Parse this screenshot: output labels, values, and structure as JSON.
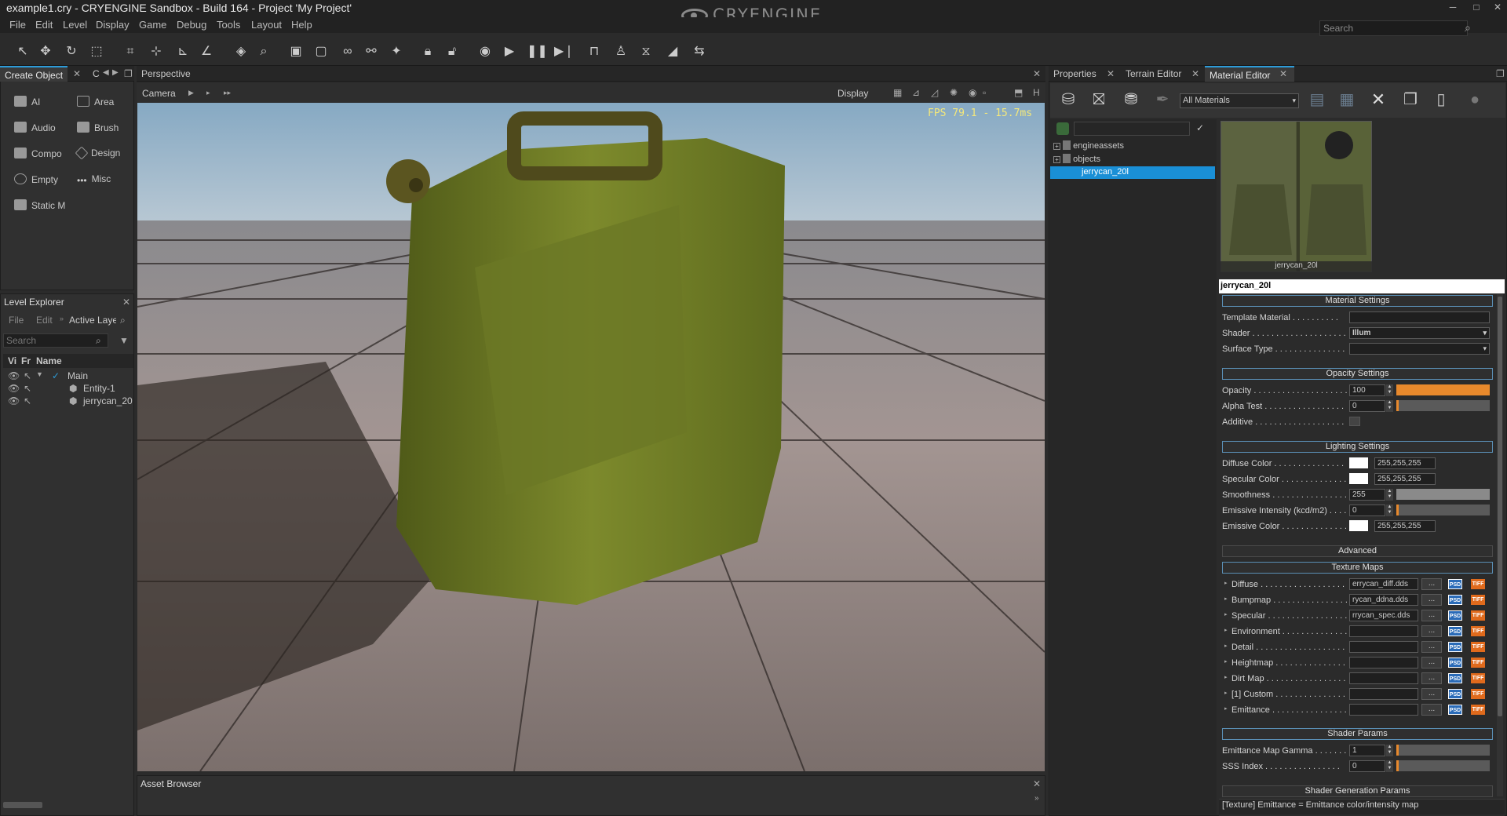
{
  "window": {
    "title": "example1.cry - CRYENGINE Sandbox - Build 164 - Project 'My Project'",
    "logo": "CRYENGINE",
    "controls": [
      "─",
      "□",
      "✕"
    ]
  },
  "menu": [
    "File",
    "Edit",
    "Level",
    "Display",
    "Game",
    "Debug",
    "Tools",
    "Layout",
    "Help"
  ],
  "search": {
    "placeholder": "Search"
  },
  "create_object": {
    "tabs": [
      "Create Object",
      "C"
    ],
    "items": [
      {
        "label": "AI",
        "icon": "ai-icon"
      },
      {
        "label": "Area",
        "icon": "area-icon"
      },
      {
        "label": "Audio",
        "icon": "audio-icon"
      },
      {
        "label": "Brush",
        "icon": "brush-icon"
      },
      {
        "label": "Compo",
        "icon": "component-icon"
      },
      {
        "label": "Design",
        "icon": "designer-icon"
      },
      {
        "label": "Empty",
        "icon": "empty-icon"
      },
      {
        "label": "Misc",
        "icon": "misc-icon"
      },
      {
        "label": "Static M",
        "icon": "static-mesh-icon"
      }
    ]
  },
  "level_explorer": {
    "title": "Level Explorer",
    "menu": [
      "File",
      "Edit",
      "Active Laye"
    ],
    "search_placeholder": "Search",
    "columns": [
      "Vi",
      "Fr",
      "Name"
    ],
    "rows": [
      "Main",
      "Entity-1",
      "jerrycan_20"
    ]
  },
  "viewport": {
    "tab": "Perspective",
    "camera": "Camera",
    "display": "Display",
    "fps": "FPS 79.1 - 15.7ms"
  },
  "asset_browser": {
    "title": "Asset Browser"
  },
  "right_tabs": [
    "Properties",
    "Terrain Editor",
    "Material Editor"
  ],
  "material_editor": {
    "filter": "All Materials",
    "tree": [
      "engineassets",
      "objects",
      "jerrycan_20l"
    ],
    "preview_label": "jerrycan_20l",
    "material_name": "jerrycan_20l",
    "sections": {
      "material": "Material Settings",
      "opacity": "Opacity Settings",
      "lighting": "Lighting Settings",
      "advanced": "Advanced",
      "texture": "Texture Maps",
      "shader_params": "Shader Params",
      "shader_gen": "Shader Generation Params"
    },
    "material_settings": [
      {
        "label": "Template Material . . . . . . . . . .",
        "value": ""
      },
      {
        "label": "Shader . . . . . . . . . . . . . . . . . . . . .",
        "value": "Illum"
      },
      {
        "label": "Surface Type . . . . . . . . . . . . . . .",
        "value": ""
      }
    ],
    "opacity_settings": [
      {
        "label": "Opacity . . . . . . . . . . . . . . . . . . . .",
        "value": "100",
        "level": 1.0
      },
      {
        "label": "Alpha Test . . . . . . . . . . . . . . . . .",
        "value": "0",
        "level": 0.0
      },
      {
        "label": "Additive . . . . . . . . . . . . . . . . . . .",
        "value": ""
      }
    ],
    "lighting_settings": [
      {
        "label": "Diffuse Color . . . . . . . . . . . . . . .",
        "value": "255,255,255"
      },
      {
        "label": "Specular Color . . . . . . . . . . . . . .",
        "value": "255,255,255"
      },
      {
        "label": "Smoothness . . . . . . . . . . . . . . . .",
        "value": "255",
        "level": 1.0
      },
      {
        "label": "Emissive Intensity (kcd/m2) . . . . .",
        "value": "0",
        "level": 0.0
      },
      {
        "label": "Emissive Color . . . . . . . . . . . . . .",
        "value": "255,255,255"
      }
    ],
    "texture_maps": [
      {
        "label": "Diffuse . . . . . . . . . . . . . . . . . .",
        "value": "errycan_diff.dds"
      },
      {
        "label": "Bumpmap . . . . . . . . . . . . . . . .",
        "value": "rycan_ddna.dds"
      },
      {
        "label": "Specular . . . . . . . . . . . . . . . . .",
        "value": "rrycan_spec.dds"
      },
      {
        "label": "Environment . . . . . . . . . . . . . .",
        "value": ""
      },
      {
        "label": "Detail . . . . . . . . . . . . . . . . . . .",
        "value": ""
      },
      {
        "label": "Heightmap . . . . . . . . . . . . . . . .",
        "value": ""
      },
      {
        "label": "Dirt Map . . . . . . . . . . . . . . . . .",
        "value": ""
      },
      {
        "label": "[1] Custom . . . . . . . . . . . . . . .",
        "value": ""
      },
      {
        "label": "Emittance . . . . . . . . . . . . . . . .",
        "value": ""
      }
    ],
    "browse": "...",
    "format_psd": "PSD",
    "format_tif": "TIFF",
    "shader_params": [
      {
        "label": "Emittance Map Gamma . . . . . . .",
        "value": "1"
      },
      {
        "label": "SSS Index . . . . . . . . . . . . . . . .",
        "value": "0"
      }
    ],
    "status": "[Texture] Emittance = Emittance color/intensity map"
  },
  "colors": {
    "accent": "#2d9bd8",
    "slider": "#e8892c",
    "selection": "#1a8fd6",
    "section_border": "#5a8fb5"
  }
}
